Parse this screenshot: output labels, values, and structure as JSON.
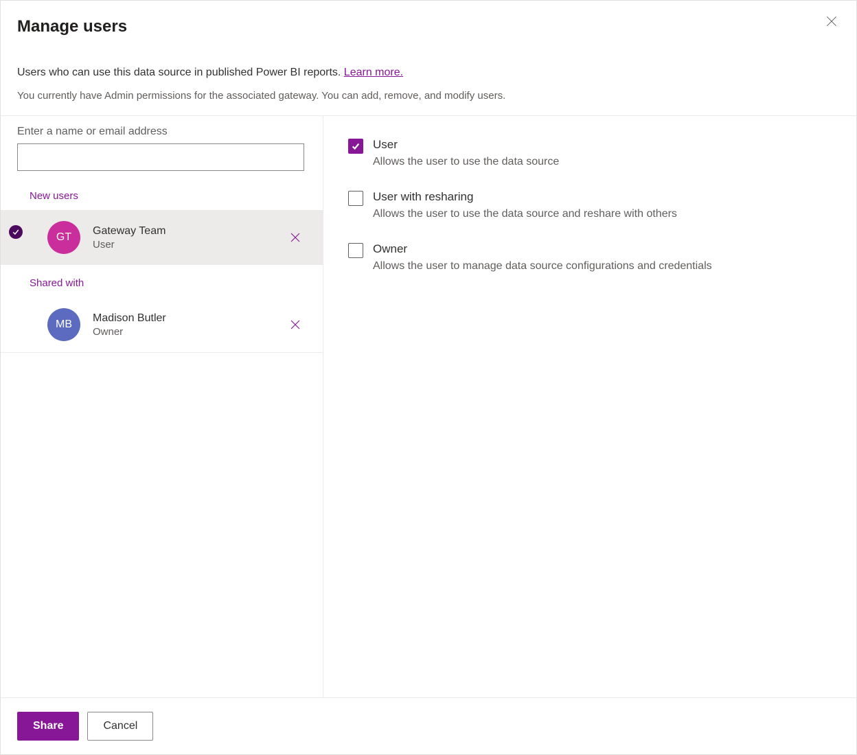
{
  "dialog": {
    "title": "Manage users",
    "description": "Users who can use this data source in published Power BI reports. ",
    "learnMore": "Learn more.",
    "permissionNote": "You currently have Admin permissions for the associated gateway. You can add, remove, and modify users."
  },
  "input": {
    "label": "Enter a name or email address",
    "value": ""
  },
  "sections": {
    "newUsers": "New users",
    "sharedWith": "Shared with"
  },
  "newUsers": [
    {
      "initials": "GT",
      "name": "Gateway Team",
      "role": "User",
      "avatarColor": "pink",
      "selected": true
    }
  ],
  "sharedWith": [
    {
      "initials": "MB",
      "name": "Madison Butler",
      "role": "Owner",
      "avatarColor": "blue",
      "selected": false
    }
  ],
  "roles": [
    {
      "label": "User",
      "description": "Allows the user to use the data source",
      "checked": true
    },
    {
      "label": "User with resharing",
      "description": "Allows the user to use the data source and reshare with others",
      "checked": false
    },
    {
      "label": "Owner",
      "description": "Allows the user to manage data source configurations and credentials",
      "checked": false
    }
  ],
  "footer": {
    "share": "Share",
    "cancel": "Cancel"
  }
}
